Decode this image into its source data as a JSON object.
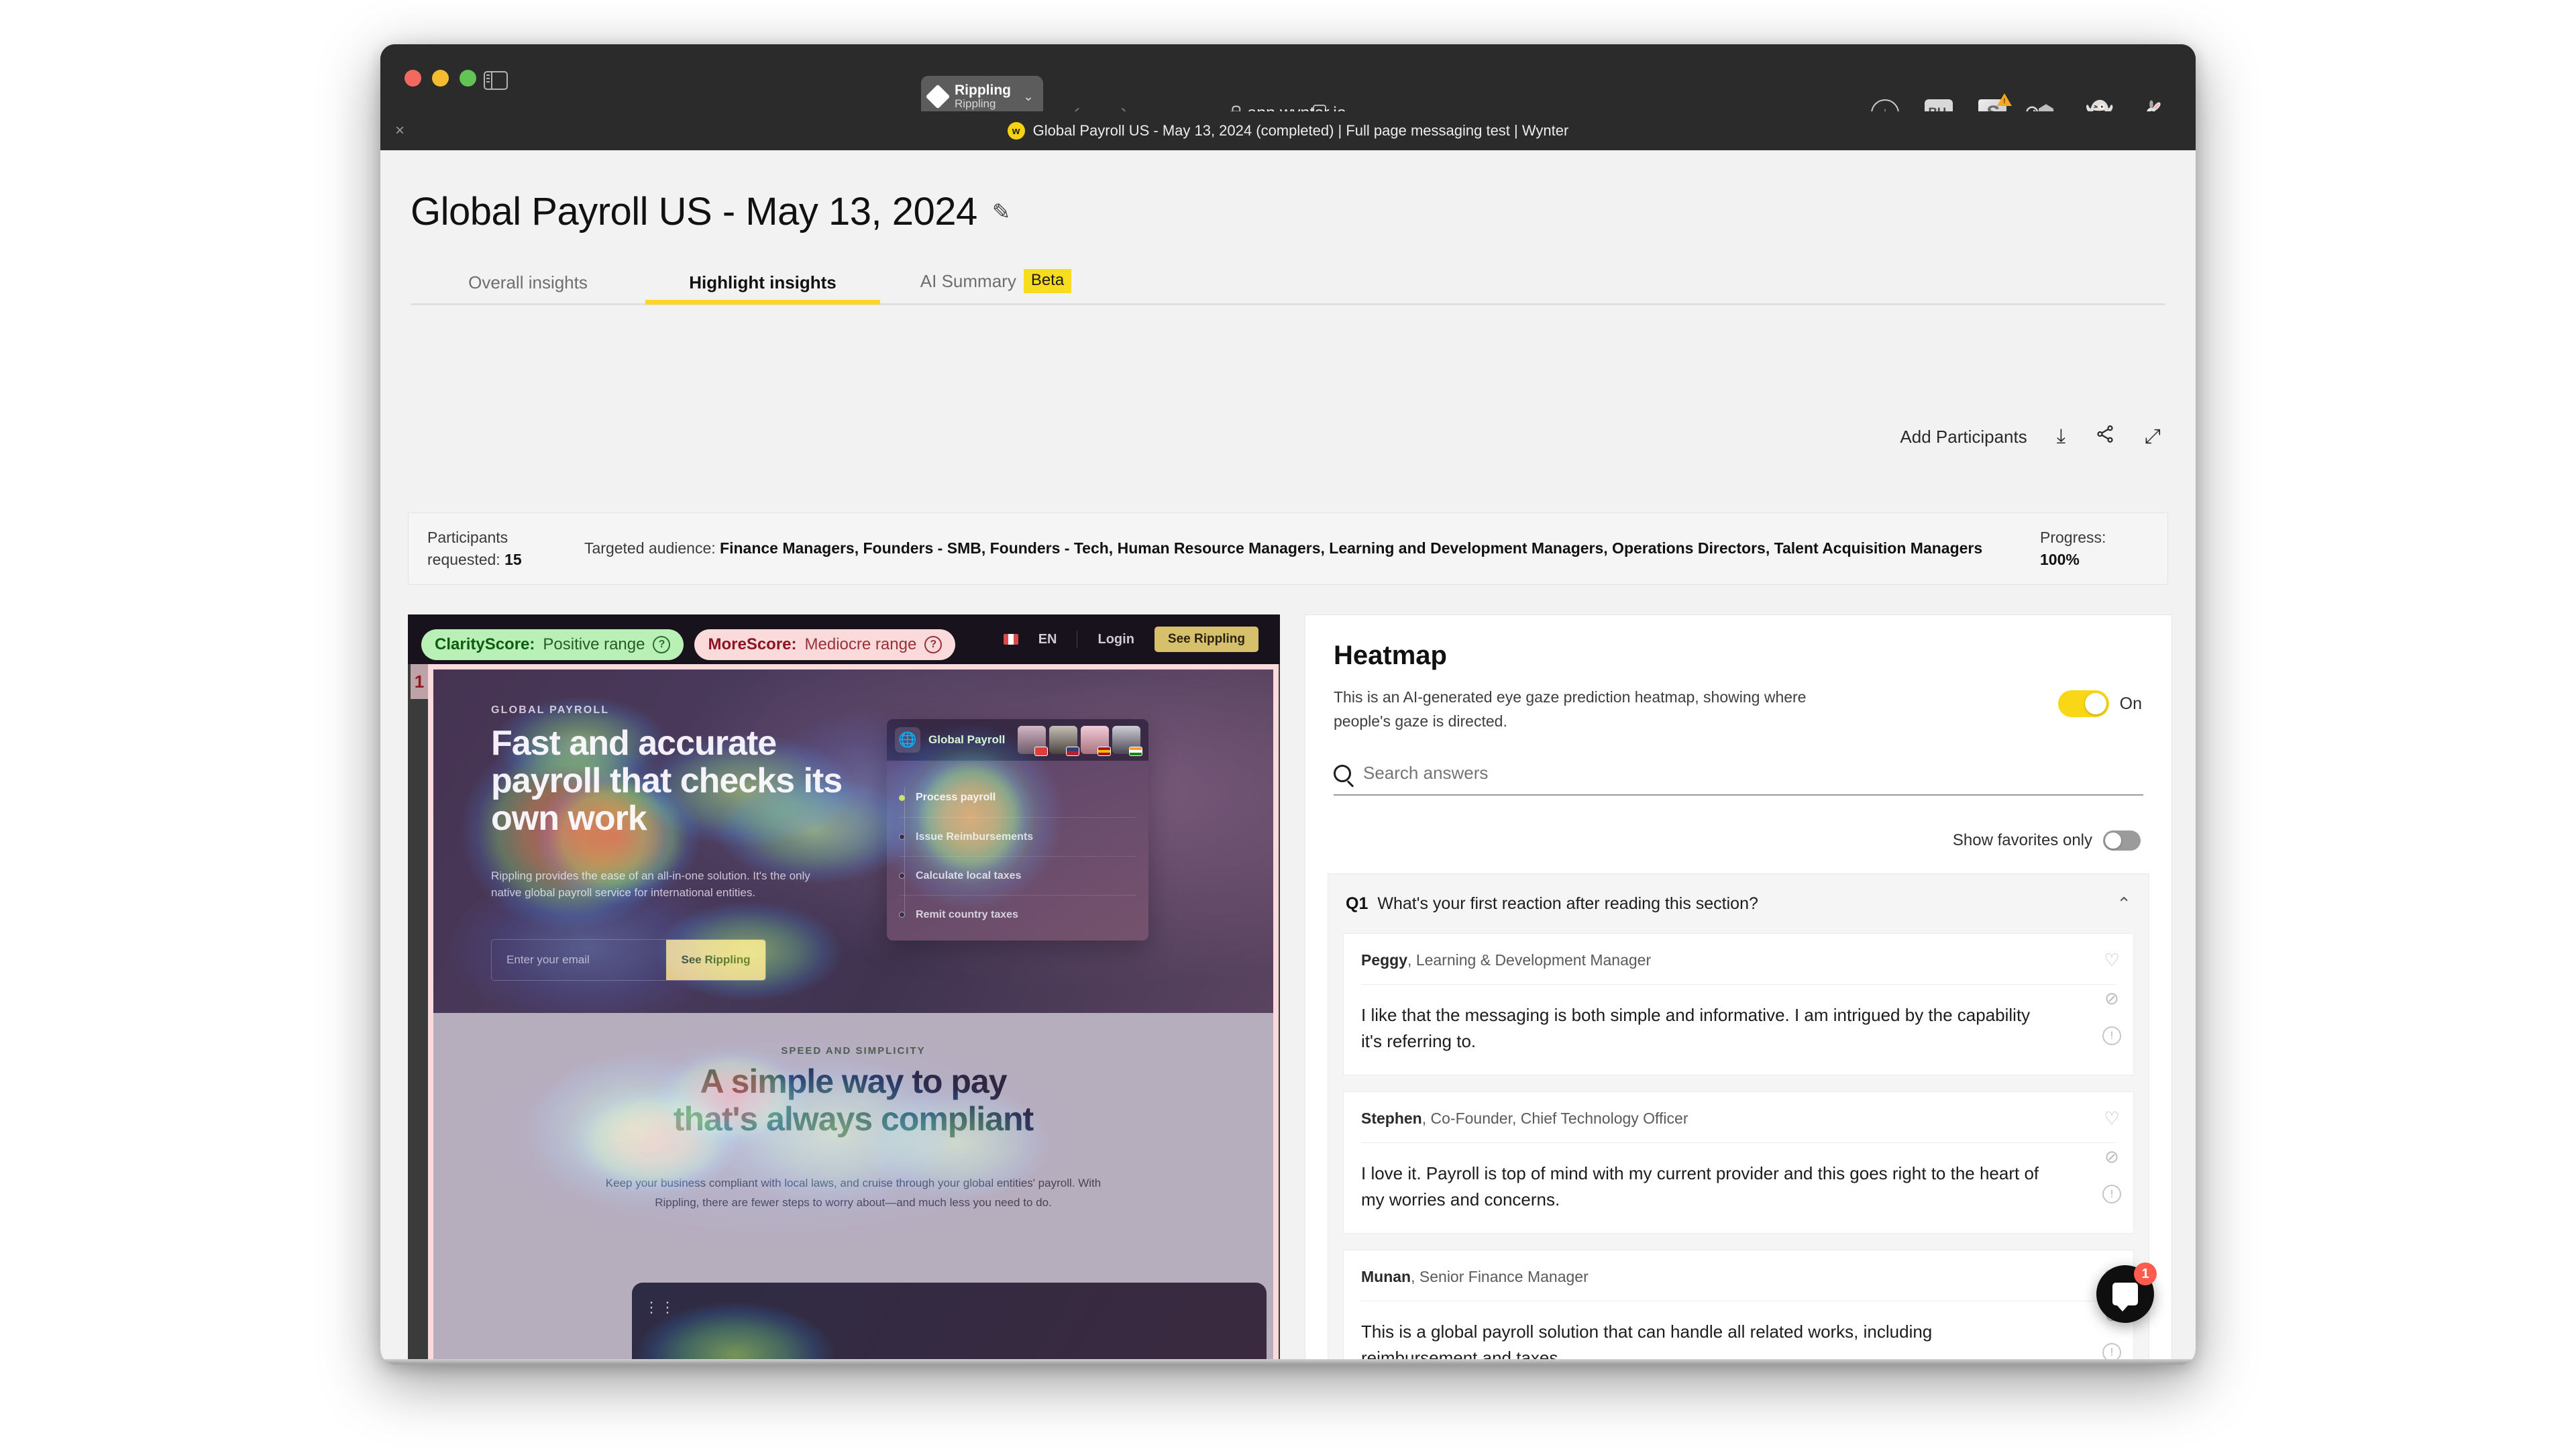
{
  "browser": {
    "profile": {
      "name": "Rippling",
      "subtitle": "Rippling",
      "chevron": "⌄",
      "icon": "diamond-icon"
    },
    "nav": {
      "back": "‹",
      "forward": "›"
    },
    "address": "app.wynter.io",
    "reload": "⟳",
    "tab_close": "×",
    "tab_favicon_letter": "w",
    "tab_title": "Global Payroll US - May 13, 2024 (completed) | Full page messaging test | Wynter",
    "extensions": [
      {
        "name": "download-icon",
        "glyph": "↓"
      },
      {
        "name": "bh-extension-icon",
        "glyph": "BH."
      },
      {
        "name": "s-extension-icon",
        "glyph": "S"
      },
      {
        "name": "pocket-icon",
        "glyph": "⌄"
      },
      {
        "name": "ghost-adblock-icon",
        "glyph": "👻"
      },
      {
        "name": "rabbit-extension-icon",
        "glyph": "🐇"
      }
    ]
  },
  "page": {
    "title": "Global Payroll US - May 13, 2024",
    "edit_icon": "✎",
    "tabs": [
      {
        "label": "Overall insights",
        "active": false
      },
      {
        "label": "Highlight insights",
        "active": true
      },
      {
        "label": "AI Summary",
        "badge": "Beta",
        "active": false
      }
    ],
    "actions": {
      "add_participants": "Add Participants",
      "download_icon": "⤓",
      "share_icon": "share-icon",
      "expand_icon": "⤢"
    },
    "infobar": {
      "participants_label": "Participants requested:",
      "participants_value": "15",
      "audience_label": "Targeted audience:",
      "audience_value": "Finance Managers,  Founders - SMB,  Founders - Tech,  Human Resource Managers,  Learning and Development Managers,  Operations Directors,  Talent Acquisition Managers",
      "progress_label": "Progress:",
      "progress_value": "100%"
    }
  },
  "heatmap_preview": {
    "section_number": "1",
    "scores": [
      {
        "name": "ClarityScore",
        "label": "ClarityScore:",
        "value": "Positive range",
        "help": "?",
        "color": "#b8f0b6"
      },
      {
        "name": "MoreScore",
        "label": "MoreScore:",
        "value": "Mediocre range",
        "help": "?",
        "color": "#fadadb"
      }
    ],
    "site_nav": {
      "lang": "EN",
      "login": "Login",
      "cta": "See Rippling"
    },
    "hero": {
      "kicker": "GLOBAL PAYROLL",
      "headline": "Fast and accurate payroll that checks its own work",
      "subhead": "Rippling provides the ease of an all-in-one solution. It's the only native global payroll service for international entities.",
      "email_placeholder": "Enter your email",
      "cta": "See Rippling"
    },
    "product_card": {
      "title": "Global Payroll",
      "steps": [
        "Process payroll",
        "Issue Reimbursements",
        "Calculate local taxes",
        "Remit country taxes"
      ]
    },
    "section2": {
      "kicker": "SPEED AND SIMPLICITY",
      "headline_line1": "A simple way to pay",
      "headline_line2": "that's always compliant",
      "body": "Keep your business compliant with local laws, and cruise through your global entities' payroll. With Rippling, there are fewer steps to worry about—and much less you need to do."
    }
  },
  "insights": {
    "heatmap": {
      "title": "Heatmap",
      "description": "This is an AI-generated eye gaze prediction heatmap, showing where people's gaze is directed.",
      "toggle_state": "On"
    },
    "search": {
      "placeholder": "Search answers",
      "value": ""
    },
    "favorites": {
      "label": "Show favorites only",
      "state": "off"
    },
    "question": {
      "number": "Q1",
      "text": "What's your first reaction after reading this section?",
      "chevron": "⌃"
    },
    "answers": [
      {
        "name": "Peggy",
        "role": "Learning & Development Manager",
        "text": "I like that the messaging is both simple and informative. I am intrigued by the capability it's referring to."
      },
      {
        "name": "Stephen",
        "role": "Co-Founder, Chief Technology Officer",
        "text": "I love it. Payroll is top of mind with my current provider and this goes right to the heart of my worries and concerns."
      },
      {
        "name": "Munan",
        "role": "Senior Finance Manager",
        "text": "This is a global payroll solution that can handle all related works, including reimbursement and taxes."
      }
    ],
    "answer_icons": {
      "favorite": "♡",
      "hide": "⊘",
      "report": "!"
    }
  },
  "intercom": {
    "unread_count": "1"
  },
  "colors": {
    "accent_yellow": "#f9d616",
    "tab_underline": "#fcd62a",
    "badge_red": "#ff5c4d"
  }
}
